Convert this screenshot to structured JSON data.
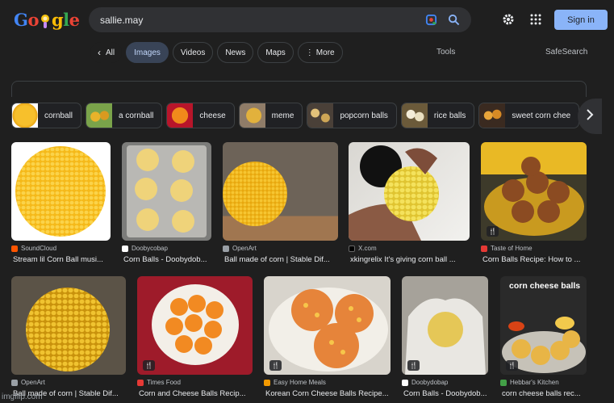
{
  "header": {
    "logo_letters": [
      "G",
      "o",
      "g",
      "l",
      "e"
    ],
    "search_value": "sallie.may",
    "sign_in": "Sign in"
  },
  "nav": {
    "back_label": "All",
    "tabs": [
      "Images",
      "Videos",
      "News",
      "Maps",
      "More"
    ],
    "tools": "Tools",
    "safesearch": "SafeSearch"
  },
  "related": [
    "cornball",
    "a cornball",
    "cheese",
    "meme",
    "popcorn balls",
    "rice balls",
    "sweet corn chee"
  ],
  "results": [
    {
      "source": "SoundCloud",
      "title": "Stream lil Corn Ball musi..."
    },
    {
      "source": "Doobycobap",
      "title": "Corn Balls - Doobydob..."
    },
    {
      "source": "OpenArt",
      "title": "Ball made of corn | Stable Dif..."
    },
    {
      "source": "X.com",
      "title": "xkingrelix It's giving corn ball ..."
    },
    {
      "source": "Taste of Home",
      "title": "Corn Balls Recipe: How to ..."
    },
    {
      "source": "OpenArt",
      "title": "Ball made of corn | Stable Dif..."
    },
    {
      "source": "Times Food",
      "title": "Corn and Cheese Balls Recip..."
    },
    {
      "source": "Easy Home Meals",
      "title": "Korean Corn Cheese Balls Recipe..."
    },
    {
      "source": "Doobydobap",
      "title": "Corn Balls - Doobydob..."
    },
    {
      "source": "Hebbar's Kitchen",
      "title": "corn cheese balls rec..."
    }
  ],
  "image_overlay_text": "corn cheese balls",
  "watermark": "imgflip.com",
  "colors": {
    "accent": "#8ab4f8",
    "background": "#1f1f1f",
    "chip_active": "#394457"
  }
}
